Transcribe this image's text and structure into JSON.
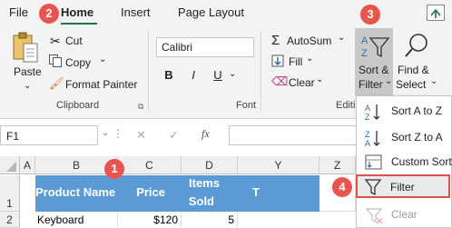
{
  "tabs": [
    "File",
    "Home",
    "Insert",
    "Page Layout"
  ],
  "badges": [
    "1",
    "2",
    "3",
    "4"
  ],
  "clipboard": {
    "paste": "Paste",
    "cut": "Cut",
    "copy": "Copy",
    "format_painter": "Format Painter",
    "group": "Clipboard"
  },
  "font": {
    "name": "Calibri",
    "bold": "B",
    "italic": "I",
    "underline": "U",
    "group": "Font"
  },
  "editing": {
    "autosum": "AutoSum",
    "fill": "Fill",
    "clear": "Clear",
    "group": "Editi",
    "sort_filter_l1": "Sort &",
    "sort_filter_l2": "Filter",
    "find_select_l1": "Find &",
    "find_select_l2": "Select"
  },
  "formula_bar": {
    "name_box": "F1",
    "fx": "fx"
  },
  "columns": [
    "A",
    "B",
    "C",
    "D",
    "Y",
    "Z"
  ],
  "rows": [
    "1",
    "2"
  ],
  "table": {
    "headers": [
      "Product Name",
      "Price",
      "Items",
      "Sold",
      "T"
    ],
    "row1": [
      "Keyboard",
      "$120",
      "5"
    ]
  },
  "sort_menu": {
    "sort_az": "Sort A to Z",
    "sort_za": "Sort Z to A",
    "custom": "Custom Sort",
    "filter": "Filter",
    "clear": "Clear"
  },
  "colors": {
    "header_fill": "#5b9bd5",
    "badge": "#e8554e",
    "accent": "#217346",
    "highlight_border": "#d9534f"
  }
}
